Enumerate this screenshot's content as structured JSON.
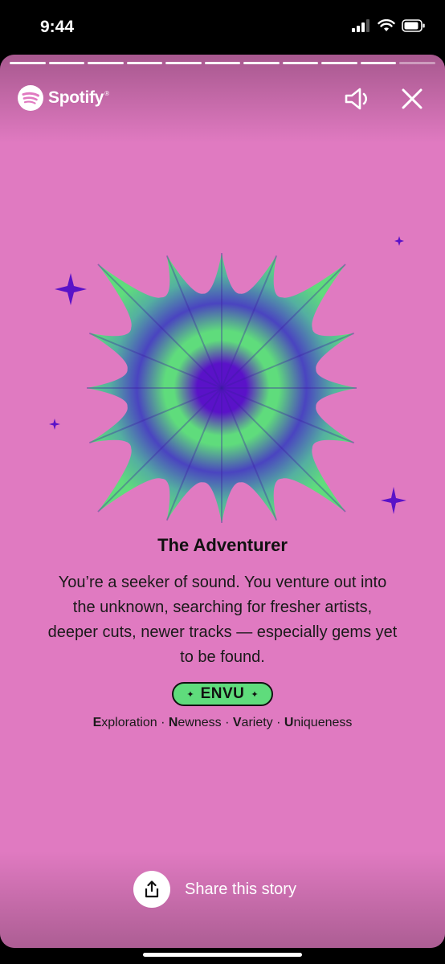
{
  "status_bar": {
    "time": "9:44"
  },
  "story": {
    "progress": {
      "segments_total": 11,
      "segments_complete": 10
    },
    "brand": {
      "name": "Spotify",
      "trademark": "®"
    },
    "personality": {
      "title": "The Adventurer",
      "description": "You’re a seeker of sound. You venture out into the unknown, searching for fresher artists, deeper cuts, newer tracks — especially gems yet to be found.",
      "badge_label": "ENVU",
      "traits": [
        {
          "initial": "E",
          "rest": "xploration"
        },
        {
          "initial": "N",
          "rest": "ewness"
        },
        {
          "initial": "V",
          "rest": "ariety"
        },
        {
          "initial": "U",
          "rest": "niqueness"
        }
      ],
      "trait_separator": " · "
    },
    "share_label": "Share this story",
    "colors": {
      "background": "#e07ac1",
      "accent_green": "#5fdc7c",
      "accent_purple": "#5a12c8"
    }
  },
  "icons": [
    "spotify-logo-icon",
    "speaker-icon",
    "close-icon",
    "share-icon",
    "signal-icon",
    "wifi-icon",
    "battery-icon",
    "sparkle-icon"
  ]
}
